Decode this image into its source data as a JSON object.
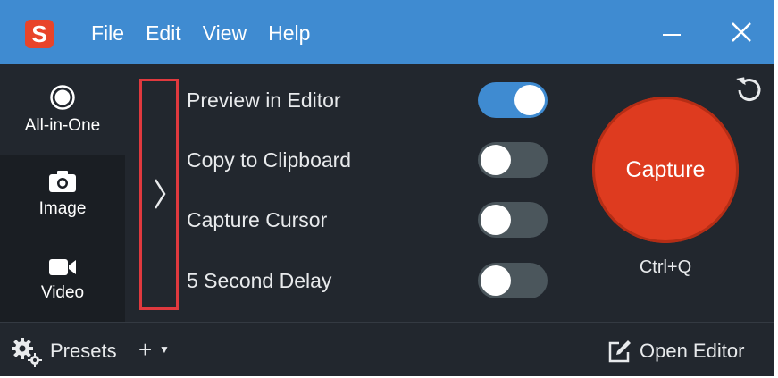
{
  "window": {
    "logo": "S",
    "menu": [
      "File",
      "Edit",
      "View",
      "Help"
    ],
    "controls": {
      "minimize_icon": "minimize-icon",
      "close_icon": "close-icon"
    }
  },
  "modes": [
    {
      "label": "All-in-One",
      "icon": "record-circle-icon",
      "selected": true
    },
    {
      "label": "Image",
      "icon": "camera-icon",
      "selected": false
    },
    {
      "label": "Video",
      "icon": "video-camera-icon",
      "selected": false
    }
  ],
  "expand_panel": {
    "icon": "chevron-right-icon"
  },
  "options": [
    {
      "label": "Preview in Editor",
      "on": true
    },
    {
      "label": "Copy to Clipboard",
      "on": false
    },
    {
      "label": "Capture Cursor",
      "on": false
    },
    {
      "label": "5 Second Delay",
      "on": false
    }
  ],
  "capture": {
    "label": "Capture",
    "shortcut": "Ctrl+Q",
    "reset_icon": "reset-icon"
  },
  "bottom": {
    "presets": "Presets",
    "add": "+",
    "open_editor": "Open Editor"
  },
  "colors": {
    "titlebar": "#3f8bd1",
    "capture": "#de3b1f",
    "toggle_on": "#3f8bd1",
    "highlight": "#e0393e"
  }
}
